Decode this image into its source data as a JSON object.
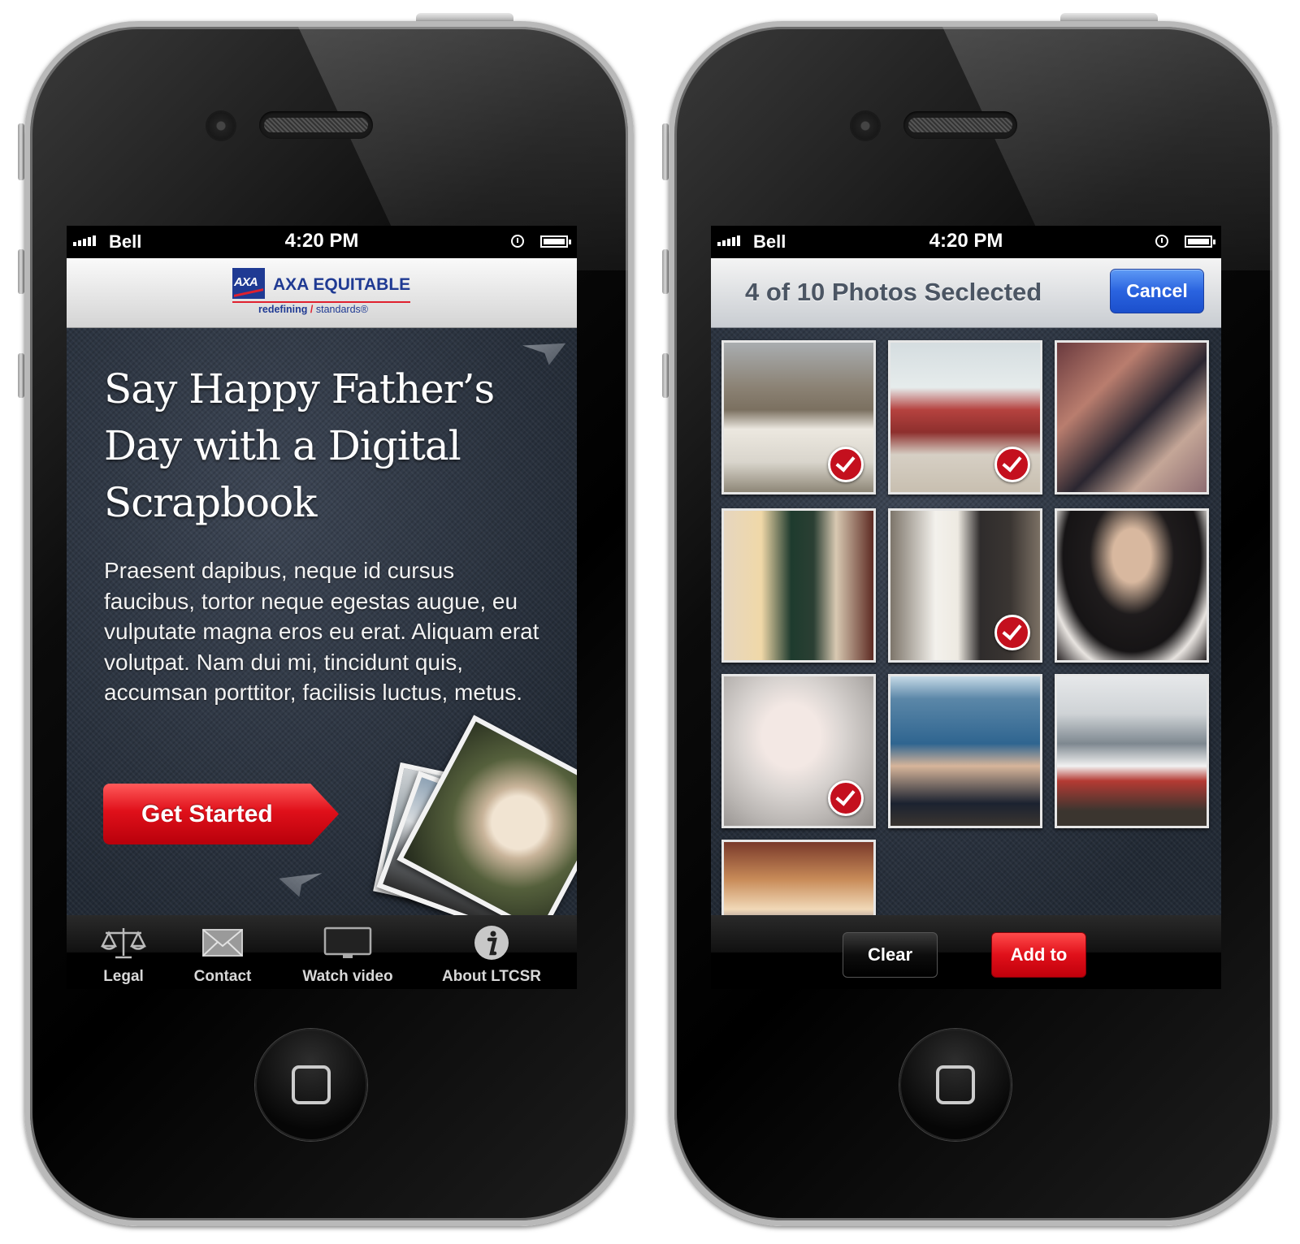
{
  "left_phone": {
    "status_bar": {
      "carrier": "Bell",
      "time": "4:20 PM"
    },
    "header": {
      "logo_mark": "AXA",
      "brand": "AXA EQUITABLE",
      "tagline_bold": "redefining",
      "tagline_sep": "/",
      "tagline_rest": "standards®"
    },
    "headline": "Say Happy Father’s Day with a Digital Scrapbook",
    "body": "Praesent dapibus, neque id cursus faucibus, tortor neque egestas augue, eu vulputate magna eros eu erat. Aliquam erat volutpat. Nam dui mi, tincidunt quis, accumsan porttitor, facilisis luctus, metus.",
    "cta_label": "Get Started",
    "tabs": [
      {
        "label": "Legal",
        "icon": "scales-icon"
      },
      {
        "label": "Contact",
        "icon": "envelope-icon"
      },
      {
        "label": "Watch video",
        "icon": "monitor-icon"
      },
      {
        "label": "About LTCSR",
        "icon": "info-icon"
      }
    ]
  },
  "right_phone": {
    "status_bar": {
      "carrier": "Bell",
      "time": "4:20 PM"
    },
    "title": "4 of 10 Photos Seclected",
    "cancel_label": "Cancel",
    "photos": [
      {
        "subject": "sailor in white uniform",
        "selected": true
      },
      {
        "subject": "red car on beach",
        "selected": true
      },
      {
        "subject": "family by christmas tree",
        "selected": false
      },
      {
        "subject": "couple by christmas tree",
        "selected": false
      },
      {
        "subject": "wedding couple",
        "selected": true
      },
      {
        "subject": "father holding baby",
        "selected": false
      },
      {
        "subject": "baby eating",
        "selected": true
      },
      {
        "subject": "child eating by the water",
        "selected": false
      },
      {
        "subject": "parade float",
        "selected": false
      },
      {
        "subject": "kids at a diner",
        "selected": false
      }
    ],
    "clear_label": "Clear",
    "add_label": "Add to"
  },
  "colors": {
    "axa_blue": "#1f3a93",
    "axa_red": "#e0202e",
    "ios_blue": "#2a63df",
    "selection_red": "#c4101e"
  }
}
